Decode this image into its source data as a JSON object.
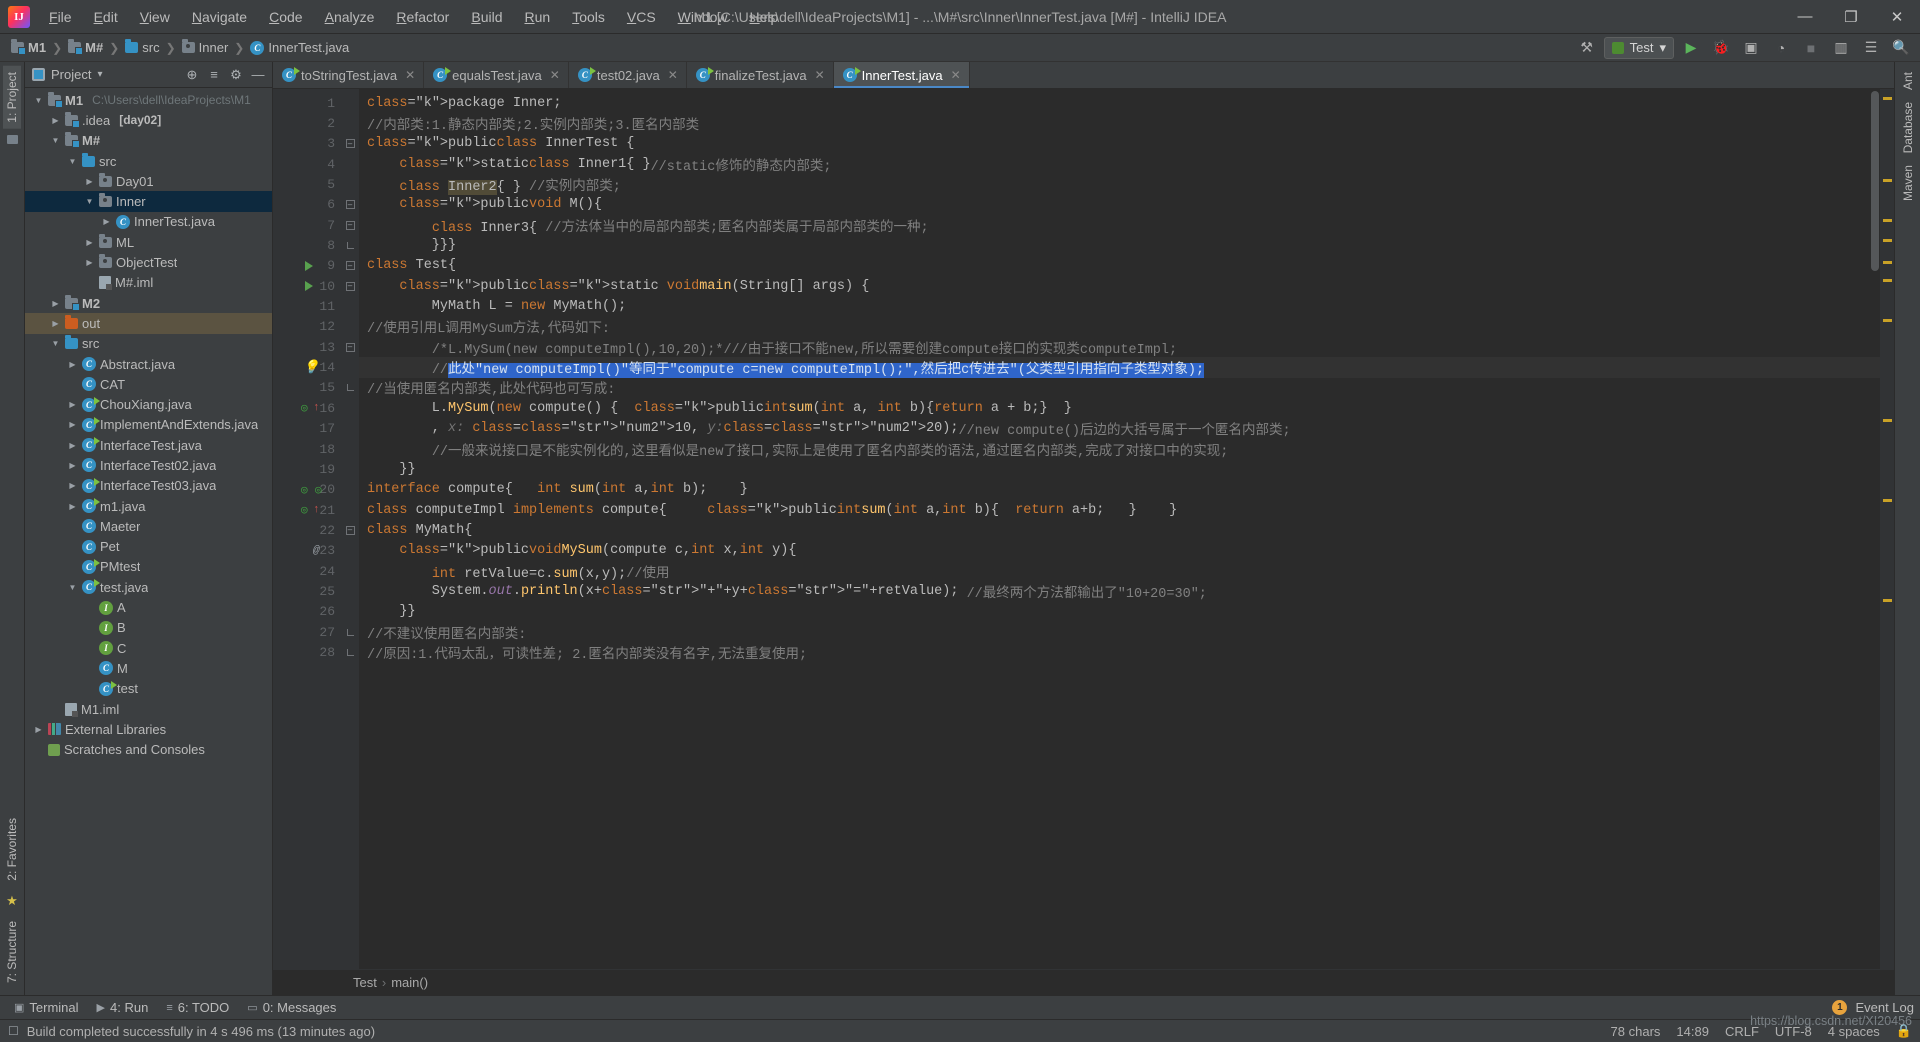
{
  "window": {
    "title": "M1 [C:\\Users\\dell\\IdeaProjects\\M1] - ...\\M#\\src\\Inner\\InnerTest.java [M#] - IntelliJ IDEA",
    "minimize": "—",
    "maximize": "❐",
    "close": "✕",
    "logo_text": "IJ"
  },
  "menu": [
    {
      "label": "File"
    },
    {
      "label": "Edit"
    },
    {
      "label": "View"
    },
    {
      "label": "Navigate"
    },
    {
      "label": "Code"
    },
    {
      "label": "Analyze"
    },
    {
      "label": "Refactor"
    },
    {
      "label": "Build"
    },
    {
      "label": "Run"
    },
    {
      "label": "Tools"
    },
    {
      "label": "VCS"
    },
    {
      "label": "Window"
    },
    {
      "label": "Help"
    }
  ],
  "breadcrumb": [
    {
      "label": "M1",
      "icon": "module-folder-icon"
    },
    {
      "label": "M#",
      "icon": "module-folder-icon"
    },
    {
      "label": "src",
      "icon": "source-folder-icon"
    },
    {
      "label": "Inner",
      "icon": "package-icon"
    },
    {
      "label": "InnerTest.java",
      "icon": "class-icon"
    }
  ],
  "navbar_right": {
    "run_config": "Test",
    "dropdown_caret": "▾",
    "build_icon": "⚒",
    "run_icon": "▶",
    "debug_icon": "🐞",
    "coverage_icon": "▣",
    "profile_icon": "◔",
    "stop_icon": "■",
    "layout_icon": "▥",
    "settings_icon": "☰",
    "search_icon": "🔍"
  },
  "left_rail": {
    "project_label": "1: Project",
    "structure_label": "7: Structure",
    "favorites_label": "2: Favorites",
    "star_icon": "★",
    "folder_icon": "🗀"
  },
  "right_rail": {
    "ant_label": "Ant",
    "database_label": "Database",
    "maven_label": "Maven"
  },
  "project_panel": {
    "title": "Project",
    "caret": "▾",
    "target_icon": "⊕",
    "collapse_icon": "≡",
    "settings_icon": "⚙",
    "hide_icon": "—",
    "tree": [
      {
        "label": "M1",
        "sub": "C:\\Users\\dell\\IdeaProjects\\M1",
        "depth": 0,
        "arrow": "open",
        "icon": "module-folder-icon",
        "bold": true,
        "state": ""
      },
      {
        "label": ".idea",
        "sub": "[day02]",
        "depth": 1,
        "arrow": "closed",
        "icon": "module-folder-icon",
        "bold": false,
        "state": ""
      },
      {
        "label": "M#",
        "sub": "",
        "depth": 1,
        "arrow": "open",
        "icon": "module-folder-icon",
        "bold": true,
        "state": ""
      },
      {
        "label": "src",
        "sub": "",
        "depth": 2,
        "arrow": "open",
        "icon": "source-folder-icon",
        "bold": false,
        "state": ""
      },
      {
        "label": "Day01",
        "sub": "",
        "depth": 3,
        "arrow": "closed",
        "icon": "package-icon",
        "bold": false,
        "state": ""
      },
      {
        "label": "Inner",
        "sub": "",
        "depth": 3,
        "arrow": "open",
        "icon": "package-icon",
        "bold": false,
        "state": "sel"
      },
      {
        "label": "InnerTest.java",
        "sub": "",
        "depth": 4,
        "arrow": "closed",
        "icon": "class-icon",
        "bold": false,
        "state": ""
      },
      {
        "label": "ML",
        "sub": "",
        "depth": 3,
        "arrow": "closed",
        "icon": "package-icon",
        "bold": false,
        "state": ""
      },
      {
        "label": "ObjectTest",
        "sub": "",
        "depth": 3,
        "arrow": "closed",
        "icon": "package-icon",
        "bold": false,
        "state": ""
      },
      {
        "label": "M#.iml",
        "sub": "",
        "depth": 3,
        "arrow": "none",
        "icon": "iml-icon",
        "bold": false,
        "state": ""
      },
      {
        "label": "M2",
        "sub": "",
        "depth": 1,
        "arrow": "closed",
        "icon": "module-folder-icon",
        "bold": true,
        "state": ""
      },
      {
        "label": "out",
        "sub": "",
        "depth": 1,
        "arrow": "closed",
        "icon": "output-folder-icon",
        "bold": false,
        "state": "sel-out"
      },
      {
        "label": "src",
        "sub": "",
        "depth": 1,
        "arrow": "open",
        "icon": "source-folder-icon",
        "bold": false,
        "state": ""
      },
      {
        "label": "Abstract.java",
        "sub": "",
        "depth": 2,
        "arrow": "closed",
        "icon": "class-icon",
        "bold": false,
        "state": ""
      },
      {
        "label": "CAT",
        "sub": "",
        "depth": 2,
        "arrow": "none",
        "icon": "class-icon",
        "bold": false,
        "state": ""
      },
      {
        "label": "ChouXiang.java",
        "sub": "",
        "depth": 2,
        "arrow": "closed",
        "icon": "class-runnable-icon",
        "bold": false,
        "state": ""
      },
      {
        "label": "ImplementAndExtends.java",
        "sub": "",
        "depth": 2,
        "arrow": "closed",
        "icon": "class-runnable-icon",
        "bold": false,
        "state": ""
      },
      {
        "label": "InterfaceTest.java",
        "sub": "",
        "depth": 2,
        "arrow": "closed",
        "icon": "class-runnable-icon",
        "bold": false,
        "state": ""
      },
      {
        "label": "InterfaceTest02.java",
        "sub": "",
        "depth": 2,
        "arrow": "closed",
        "icon": "class-icon",
        "bold": false,
        "state": ""
      },
      {
        "label": "InterfaceTest03.java",
        "sub": "",
        "depth": 2,
        "arrow": "closed",
        "icon": "class-runnable-icon",
        "bold": false,
        "state": ""
      },
      {
        "label": "m1.java",
        "sub": "",
        "depth": 2,
        "arrow": "closed",
        "icon": "class-runnable-icon",
        "bold": false,
        "state": ""
      },
      {
        "label": "Maeter",
        "sub": "",
        "depth": 2,
        "arrow": "none",
        "icon": "class-icon",
        "bold": false,
        "state": ""
      },
      {
        "label": "Pet",
        "sub": "",
        "depth": 2,
        "arrow": "none",
        "icon": "class-icon",
        "bold": false,
        "state": ""
      },
      {
        "label": "PMtest",
        "sub": "",
        "depth": 2,
        "arrow": "none",
        "icon": "class-runnable-icon",
        "bold": false,
        "state": ""
      },
      {
        "label": "test.java",
        "sub": "",
        "depth": 2,
        "arrow": "open",
        "icon": "class-runnable-icon",
        "bold": false,
        "state": ""
      },
      {
        "label": "A",
        "sub": "",
        "depth": 3,
        "arrow": "none",
        "icon": "interface-icon",
        "bold": false,
        "state": ""
      },
      {
        "label": "B",
        "sub": "",
        "depth": 3,
        "arrow": "none",
        "icon": "interface-icon",
        "bold": false,
        "state": ""
      },
      {
        "label": "C",
        "sub": "",
        "depth": 3,
        "arrow": "none",
        "icon": "interface-icon",
        "bold": false,
        "state": ""
      },
      {
        "label": "M",
        "sub": "",
        "depth": 3,
        "arrow": "none",
        "icon": "class-icon",
        "bold": false,
        "state": ""
      },
      {
        "label": "test",
        "sub": "",
        "depth": 3,
        "arrow": "none",
        "icon": "class-runnable-icon",
        "bold": false,
        "state": ""
      },
      {
        "label": "M1.iml",
        "sub": "",
        "depth": 1,
        "arrow": "none",
        "icon": "iml-icon",
        "bold": false,
        "state": ""
      },
      {
        "label": "External Libraries",
        "sub": "",
        "depth": 0,
        "arrow": "closed",
        "icon": "library-icon",
        "bold": false,
        "state": ""
      },
      {
        "label": "Scratches and Consoles",
        "sub": "",
        "depth": 0,
        "arrow": "none",
        "icon": "scratch-icon",
        "bold": false,
        "state": ""
      }
    ]
  },
  "editor_tabs": [
    {
      "label": "toStringTest.java",
      "active": false,
      "icon": "class-runnable-icon"
    },
    {
      "label": "equalsTest.java",
      "active": false,
      "icon": "class-runnable-icon"
    },
    {
      "label": "test02.java",
      "active": false,
      "icon": "class-runnable-icon"
    },
    {
      "label": "finalizeTest.java",
      "active": false,
      "icon": "class-runnable-icon"
    },
    {
      "label": "InnerTest.java",
      "active": true,
      "icon": "class-runnable-icon"
    }
  ],
  "editor": {
    "close_glyph": "✕",
    "lines": [
      {
        "n": 1,
        "indent": 0,
        "fold": "",
        "mark": "",
        "text": "package Inner;"
      },
      {
        "n": 2,
        "indent": 0,
        "fold": "",
        "mark": "",
        "text": "//内部类:1.静态内部类;2.实例内部类;3.匿名内部类"
      },
      {
        "n": 3,
        "indent": 0,
        "fold": "open",
        "mark": "",
        "text": "public class InnerTest {"
      },
      {
        "n": 4,
        "indent": 1,
        "fold": "",
        "mark": "",
        "text": "static class Inner1{ }//static修饰的静态内部类;"
      },
      {
        "n": 5,
        "indent": 1,
        "fold": "",
        "mark": "",
        "text": "class Inner2{ } //实例内部类;"
      },
      {
        "n": 6,
        "indent": 1,
        "fold": "open",
        "mark": "",
        "text": "public void M(){"
      },
      {
        "n": 7,
        "indent": 2,
        "fold": "open",
        "mark": "",
        "text": "class Inner3{ //方法体当中的局部内部类;匿名内部类属于局部内部类的一种;"
      },
      {
        "n": 8,
        "indent": 2,
        "fold": "close",
        "mark": "",
        "text": "}}}"
      },
      {
        "n": 9,
        "indent": 0,
        "fold": "open",
        "mark": "run",
        "text": "class Test{"
      },
      {
        "n": 10,
        "indent": 1,
        "fold": "open",
        "mark": "run",
        "text": "public static void main(String[] args) {"
      },
      {
        "n": 11,
        "indent": 2,
        "fold": "",
        "mark": "",
        "text": "MyMath L = new MyMath();"
      },
      {
        "n": 12,
        "indent": 0,
        "fold": "",
        "mark": "",
        "text": "//使用引用L调用MySum方法,代码如下:"
      },
      {
        "n": 13,
        "indent": 2,
        "fold": "open",
        "mark": "",
        "text": "/*L.MySum(new computeImpl(),10,20);*///由于接口不能new,所以需要创建compute接口的实现类computeImpl;"
      },
      {
        "n": 14,
        "indent": 2,
        "fold": "",
        "mark": "bulb",
        "text": "//此处\"new computeImpl()\"等同于\"compute c=new computeImpl();\",然后把c传进去\"(父类型引用指向子类型对象);"
      },
      {
        "n": 15,
        "indent": 0,
        "fold": "close",
        "mark": "",
        "text": "//当使用匿名内部类,此处代码也可写成:"
      },
      {
        "n": 16,
        "indent": 2,
        "fold": "",
        "mark": "impl",
        "text": "L.MySum(new compute() {  public int sum(int a, int b){return a + b;}  }"
      },
      {
        "n": 17,
        "indent": 2,
        "fold": "",
        "mark": "",
        "text": ", x: 10, y: 20);//new compute()后边的大括号属于一个匿名内部类;"
      },
      {
        "n": 18,
        "indent": 2,
        "fold": "",
        "mark": "",
        "text": "//一般来说接口是不能实例化的,这里看似是new了接口,实际上是使用了匿名内部类的语法,通过匿名内部类,完成了对接口中的实现;"
      },
      {
        "n": 19,
        "indent": 1,
        "fold": "",
        "mark": "",
        "text": "}}"
      },
      {
        "n": 20,
        "indent": 0,
        "fold": "",
        "mark": "iface",
        "text": "interface compute{   int sum(int a,int b);    }"
      },
      {
        "n": 21,
        "indent": 0,
        "fold": "",
        "mark": "impl",
        "text": "class computeImpl implements compute{     public int sum(int a,int b){  return a+b;   }    }"
      },
      {
        "n": 22,
        "indent": 0,
        "fold": "open",
        "mark": "",
        "text": "class MyMath{"
      },
      {
        "n": 23,
        "indent": 1,
        "fold": "",
        "mark": "at",
        "text": "public void MySum(compute c,int x,int y){"
      },
      {
        "n": 24,
        "indent": 2,
        "fold": "",
        "mark": "",
        "text": "int retValue=c.sum(x,y);//使用"
      },
      {
        "n": 25,
        "indent": 2,
        "fold": "",
        "mark": "",
        "text": "System.out.println(x+\"+\"+y+\"=\"+retValue); //最终两个方法都输出了\"10+20=30\";"
      },
      {
        "n": 26,
        "indent": 1,
        "fold": "",
        "mark": "",
        "text": "}}"
      },
      {
        "n": 27,
        "indent": 0,
        "fold": "close",
        "mark": "",
        "text": "//不建议使用匿名内部类:"
      },
      {
        "n": 28,
        "indent": 0,
        "fold": "close",
        "mark": "",
        "text": "//原因:1.代码太乱，可读性差; 2.匿名内部类没有名字,无法重复使用;"
      }
    ],
    "selected_token": "Inner2",
    "selected_line_text": "//此处\"new computeImpl()\"等同于\"compute c=new computeImpl();\",然后把c传进去\"(父类型引用指向子类型对象);"
  },
  "editor_breadcrumb": {
    "class": "Test",
    "sep": "›",
    "method": "main()"
  },
  "bottom_toolbar": [
    {
      "label": "Terminal",
      "icon": "terminal-icon"
    },
    {
      "label": "4: Run",
      "icon": "run-icon"
    },
    {
      "label": "6: TODO",
      "icon": "todo-icon"
    },
    {
      "label": "0: Messages",
      "icon": "messages-icon"
    }
  ],
  "bottom_right": {
    "event_count": "1",
    "event_label": "Event Log"
  },
  "statusbar": {
    "message": "Build completed successfully in 4 s 496 ms (13 minutes ago)",
    "chars": "78 chars",
    "caret": "14:89",
    "line_sep": "CRLF",
    "encoding": "UTF-8",
    "indent": "4 spaces",
    "lock_icon": "🔒",
    "watermark": "https://blog.csdn.net/XI20456"
  },
  "colors": {
    "accent": "#4a88c7",
    "selection": "#2f65ca",
    "tree_selection": "#0d293e",
    "out_folder": "#5b5341",
    "keyword": "#cc7832",
    "comment": "#808080",
    "string": "#6a8759",
    "number": "#6897bb",
    "method": "#ffc66d",
    "bg_editor": "#2b2b2b",
    "bg_panel": "#3c3f41"
  }
}
